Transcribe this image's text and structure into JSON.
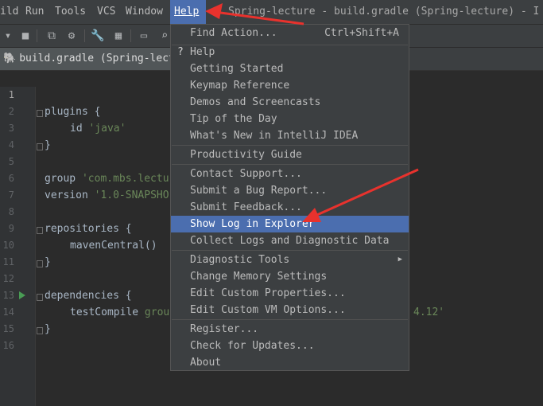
{
  "menubar": {
    "items": [
      {
        "label": "ild",
        "underline": ""
      },
      {
        "label": "Run",
        "underline": "R"
      },
      {
        "label": "Tools",
        "underline": "T"
      },
      {
        "label": "VCS",
        "underline": ""
      },
      {
        "label": "Window",
        "underline": "W"
      },
      {
        "label": "Help",
        "underline": "H"
      }
    ],
    "window_title": "Spring-lecture - build.gradle (Spring-lecture) - I"
  },
  "tab": {
    "label": "build.gradle (Spring-lecture)"
  },
  "editor": {
    "line_numbers": [
      "1",
      "2",
      "3",
      "4",
      "5",
      "6",
      "7",
      "8",
      "9",
      "10",
      "11",
      "12",
      "13",
      "14",
      "15",
      "16"
    ],
    "lines": {
      "l2": "plugins {",
      "l3_kw": "id ",
      "l3_str": "'java'",
      "l4": "}",
      "l6_kw": "group ",
      "l6_str": "'com.mbs.lectu",
      "l7_kw": "version ",
      "l7_str": "'1.0-SNAPSHO",
      "l9": "repositories {",
      "l10": "mavenCentral()",
      "l11": "}",
      "l13": "dependencies {",
      "l14_a": "testCompile ",
      "l14_b": "grou",
      "l14_tail": "4.12'",
      "l15": "}"
    }
  },
  "help_menu": {
    "find_action": {
      "label": "Find Action...",
      "shortcut": "Ctrl+Shift+A"
    },
    "help": "Help",
    "getting_started": "Getting Started",
    "keymap_reference": "Keymap Reference",
    "demos": "Demos and Screencasts",
    "tip": "Tip of the Day",
    "whats_new": "What's New in IntelliJ IDEA",
    "productivity": "Productivity Guide",
    "contact": "Contact Support...",
    "bug": "Submit a Bug Report...",
    "feedback": "Submit Feedback...",
    "show_log": "Show Log in Explorer",
    "collect_logs": "Collect Logs and Diagnostic Data",
    "diagnostic": "Diagnostic Tools",
    "memory": "Change Memory Settings",
    "custom_props": "Edit Custom Properties...",
    "custom_vm": "Edit Custom VM Options...",
    "register": "Register...",
    "updates": "Check for Updates...",
    "about": "About"
  },
  "colors": {
    "selection": "#4b6eaf",
    "annotation_arrow": "#e8322d",
    "string": "#6a8759",
    "keyword": "#cc7832"
  }
}
